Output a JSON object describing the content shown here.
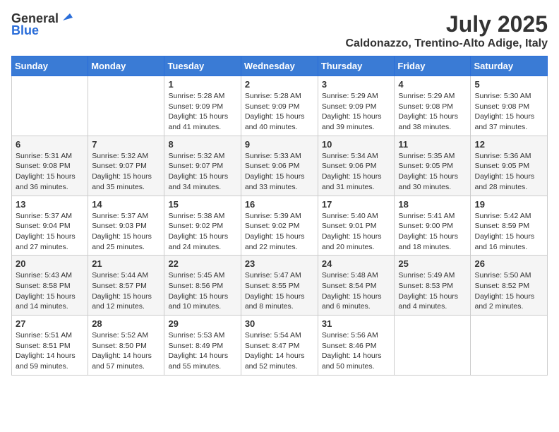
{
  "header": {
    "logo_general": "General",
    "logo_blue": "Blue",
    "month_year": "July 2025",
    "location": "Caldonazzo, Trentino-Alto Adige, Italy"
  },
  "calendar": {
    "weekdays": [
      "Sunday",
      "Monday",
      "Tuesday",
      "Wednesday",
      "Thursday",
      "Friday",
      "Saturday"
    ],
    "weeks": [
      [
        {
          "day": "",
          "info": ""
        },
        {
          "day": "",
          "info": ""
        },
        {
          "day": "1",
          "info": "Sunrise: 5:28 AM\nSunset: 9:09 PM\nDaylight: 15 hours and 41 minutes."
        },
        {
          "day": "2",
          "info": "Sunrise: 5:28 AM\nSunset: 9:09 PM\nDaylight: 15 hours and 40 minutes."
        },
        {
          "day": "3",
          "info": "Sunrise: 5:29 AM\nSunset: 9:09 PM\nDaylight: 15 hours and 39 minutes."
        },
        {
          "day": "4",
          "info": "Sunrise: 5:29 AM\nSunset: 9:08 PM\nDaylight: 15 hours and 38 minutes."
        },
        {
          "day": "5",
          "info": "Sunrise: 5:30 AM\nSunset: 9:08 PM\nDaylight: 15 hours and 37 minutes."
        }
      ],
      [
        {
          "day": "6",
          "info": "Sunrise: 5:31 AM\nSunset: 9:08 PM\nDaylight: 15 hours and 36 minutes."
        },
        {
          "day": "7",
          "info": "Sunrise: 5:32 AM\nSunset: 9:07 PM\nDaylight: 15 hours and 35 minutes."
        },
        {
          "day": "8",
          "info": "Sunrise: 5:32 AM\nSunset: 9:07 PM\nDaylight: 15 hours and 34 minutes."
        },
        {
          "day": "9",
          "info": "Sunrise: 5:33 AM\nSunset: 9:06 PM\nDaylight: 15 hours and 33 minutes."
        },
        {
          "day": "10",
          "info": "Sunrise: 5:34 AM\nSunset: 9:06 PM\nDaylight: 15 hours and 31 minutes."
        },
        {
          "day": "11",
          "info": "Sunrise: 5:35 AM\nSunset: 9:05 PM\nDaylight: 15 hours and 30 minutes."
        },
        {
          "day": "12",
          "info": "Sunrise: 5:36 AM\nSunset: 9:05 PM\nDaylight: 15 hours and 28 minutes."
        }
      ],
      [
        {
          "day": "13",
          "info": "Sunrise: 5:37 AM\nSunset: 9:04 PM\nDaylight: 15 hours and 27 minutes."
        },
        {
          "day": "14",
          "info": "Sunrise: 5:37 AM\nSunset: 9:03 PM\nDaylight: 15 hours and 25 minutes."
        },
        {
          "day": "15",
          "info": "Sunrise: 5:38 AM\nSunset: 9:02 PM\nDaylight: 15 hours and 24 minutes."
        },
        {
          "day": "16",
          "info": "Sunrise: 5:39 AM\nSunset: 9:02 PM\nDaylight: 15 hours and 22 minutes."
        },
        {
          "day": "17",
          "info": "Sunrise: 5:40 AM\nSunset: 9:01 PM\nDaylight: 15 hours and 20 minutes."
        },
        {
          "day": "18",
          "info": "Sunrise: 5:41 AM\nSunset: 9:00 PM\nDaylight: 15 hours and 18 minutes."
        },
        {
          "day": "19",
          "info": "Sunrise: 5:42 AM\nSunset: 8:59 PM\nDaylight: 15 hours and 16 minutes."
        }
      ],
      [
        {
          "day": "20",
          "info": "Sunrise: 5:43 AM\nSunset: 8:58 PM\nDaylight: 15 hours and 14 minutes."
        },
        {
          "day": "21",
          "info": "Sunrise: 5:44 AM\nSunset: 8:57 PM\nDaylight: 15 hours and 12 minutes."
        },
        {
          "day": "22",
          "info": "Sunrise: 5:45 AM\nSunset: 8:56 PM\nDaylight: 15 hours and 10 minutes."
        },
        {
          "day": "23",
          "info": "Sunrise: 5:47 AM\nSunset: 8:55 PM\nDaylight: 15 hours and 8 minutes."
        },
        {
          "day": "24",
          "info": "Sunrise: 5:48 AM\nSunset: 8:54 PM\nDaylight: 15 hours and 6 minutes."
        },
        {
          "day": "25",
          "info": "Sunrise: 5:49 AM\nSunset: 8:53 PM\nDaylight: 15 hours and 4 minutes."
        },
        {
          "day": "26",
          "info": "Sunrise: 5:50 AM\nSunset: 8:52 PM\nDaylight: 15 hours and 2 minutes."
        }
      ],
      [
        {
          "day": "27",
          "info": "Sunrise: 5:51 AM\nSunset: 8:51 PM\nDaylight: 14 hours and 59 minutes."
        },
        {
          "day": "28",
          "info": "Sunrise: 5:52 AM\nSunset: 8:50 PM\nDaylight: 14 hours and 57 minutes."
        },
        {
          "day": "29",
          "info": "Sunrise: 5:53 AM\nSunset: 8:49 PM\nDaylight: 14 hours and 55 minutes."
        },
        {
          "day": "30",
          "info": "Sunrise: 5:54 AM\nSunset: 8:47 PM\nDaylight: 14 hours and 52 minutes."
        },
        {
          "day": "31",
          "info": "Sunrise: 5:56 AM\nSunset: 8:46 PM\nDaylight: 14 hours and 50 minutes."
        },
        {
          "day": "",
          "info": ""
        },
        {
          "day": "",
          "info": ""
        }
      ]
    ]
  }
}
